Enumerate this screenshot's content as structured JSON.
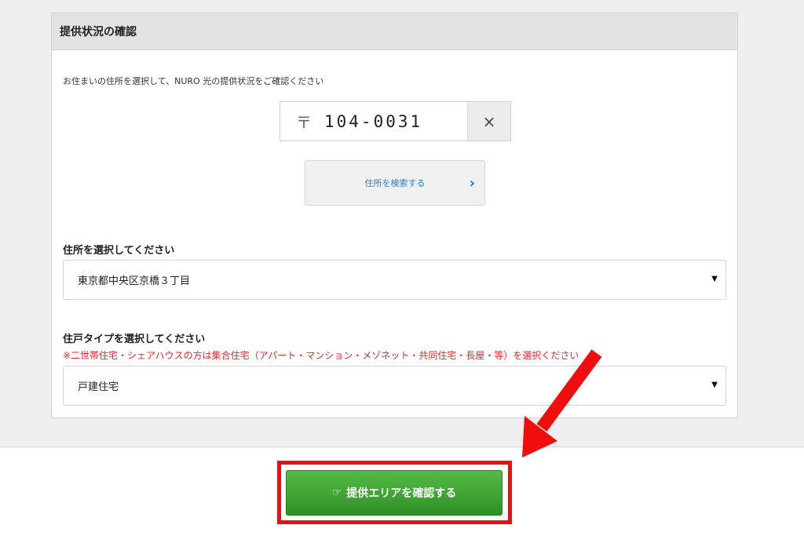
{
  "card": {
    "title": "提供状況の確認",
    "intro": "お住まいの住所を選択して、NURO 光の提供状況をご確認ください"
  },
  "zip": {
    "mark": "〒",
    "value": "104-0031",
    "clear_label": "×"
  },
  "search_button": {
    "label": "住所を検索する",
    "chevron": "›"
  },
  "address": {
    "label": "住所を選択してください",
    "selected": "東京都中央区京橋３丁目",
    "caret": "▼"
  },
  "house_type": {
    "label": "住戸タイプを選択してください",
    "warning": "※二世帯住宅・シェアハウスの方は集合住宅（アパート・マンション・メゾネット・共同住宅・長屋・等）を選択ください",
    "selected": "戸建住宅",
    "caret": "▼"
  },
  "confirm_button": {
    "icon": "☞",
    "label": "提供エリアを確認する"
  },
  "colors": {
    "accent_blue": "#2a7fc5",
    "warning_red": "#e8262a",
    "button_green": "#3fa433",
    "highlight_red": "#f00d0d"
  }
}
